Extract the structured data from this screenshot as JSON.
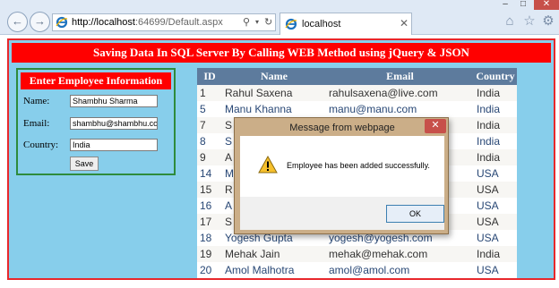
{
  "browser": {
    "url_host": "http://localhost",
    "url_rest": ":64699/Default.aspx",
    "tab_title": "localhost",
    "window_controls": {
      "minimize": "–",
      "maximize": "□",
      "close": "✕"
    },
    "nav": {
      "back": "←",
      "forward": "→",
      "search_glyph": "⚲",
      "dropdown_glyph": "▾",
      "refresh_glyph": "↻",
      "tab_close": "✕"
    },
    "toolbar": {
      "home": "⌂",
      "favorites": "☆",
      "settings": "⚙"
    }
  },
  "page": {
    "banner": "Saving Data In SQL Server By Calling WEB Method using jQuery & JSON",
    "form": {
      "title": "Enter Employee Information",
      "name_label": "Name:",
      "name_value": "Shambhu Sharma",
      "email_label": "Email:",
      "email_value": "shambhu@shambhu.con",
      "country_label": "Country:",
      "country_value": "India",
      "save_label": "Save"
    },
    "table": {
      "headers": [
        "ID",
        "Name",
        "Email",
        "Country"
      ],
      "rows": [
        [
          "1",
          "Rahul Saxena",
          "rahulsaxena@live.com",
          "India"
        ],
        [
          "5",
          "Manu Khanna",
          "manu@manu.com",
          "India"
        ],
        [
          "7",
          "S",
          "",
          "India"
        ],
        [
          "8",
          "S",
          "a",
          "India"
        ],
        [
          "9",
          "A",
          "",
          "India"
        ],
        [
          "14",
          "M",
          "",
          "USA"
        ],
        [
          "15",
          "R",
          "",
          "USA"
        ],
        [
          "16",
          "A",
          "",
          "USA"
        ],
        [
          "17",
          "S",
          "",
          "USA"
        ],
        [
          "18",
          "Yogesh Gupta",
          "yogesh@yogesh.com",
          "USA"
        ],
        [
          "19",
          "Mehak Jain",
          "mehak@mehak.com",
          "India"
        ],
        [
          "20",
          "Amol Malhotra",
          "amol@amol.com",
          "USA"
        ]
      ]
    }
  },
  "dialog": {
    "title": "Message from webpage",
    "close_glyph": "✕",
    "message": "Employee has been added successfully.",
    "ok_label": "OK"
  },
  "colors": {
    "banner_bg": "#ff0000",
    "page_bg": "#87ceeb",
    "table_header_bg": "#5d7b9d",
    "row_odd_bg": "#f7f6f3",
    "row_even_text": "#284775",
    "form_border": "#2e8b3c",
    "dialog_frame": "#cbae88"
  }
}
